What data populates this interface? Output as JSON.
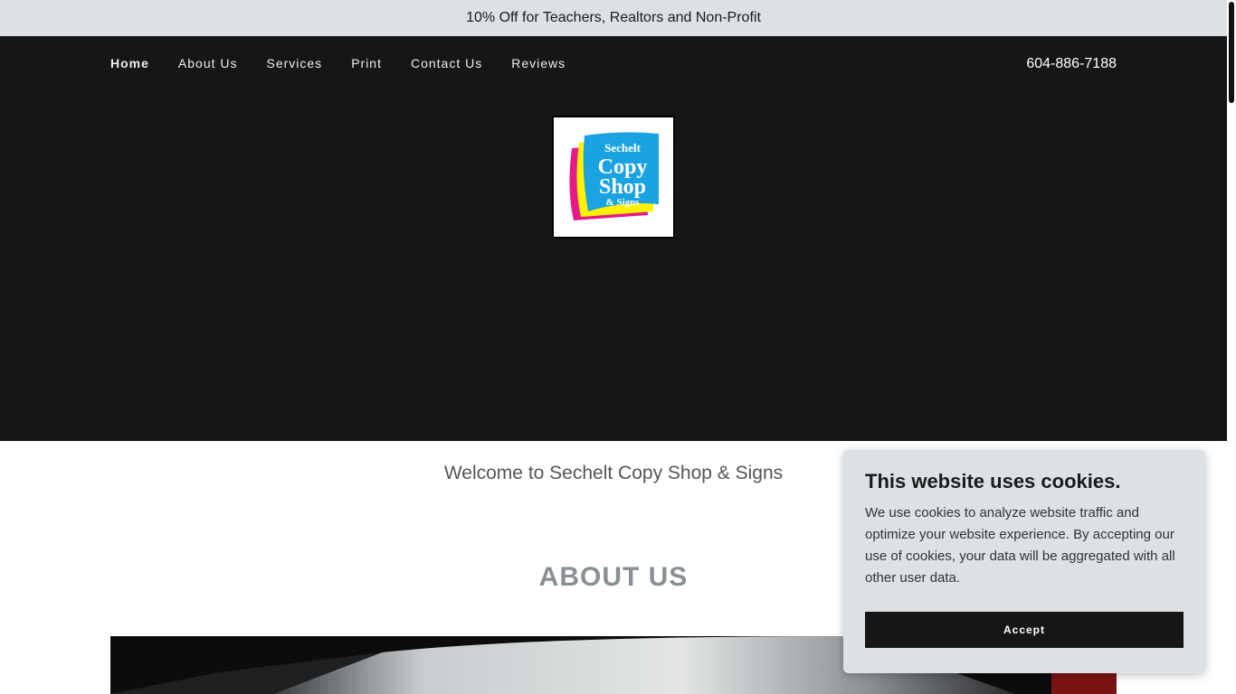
{
  "promo": {
    "text": "10% Off for Teachers, Realtors and Non-Profit"
  },
  "nav": {
    "items": [
      {
        "label": "Home"
      },
      {
        "label": "About Us"
      },
      {
        "label": "Services"
      },
      {
        "label": "Print"
      },
      {
        "label": "Contact Us"
      },
      {
        "label": "Reviews"
      }
    ],
    "active": "Home",
    "phone": "604-886-7188"
  },
  "logo": {
    "line1": "Sechelt",
    "line2": "Copy",
    "line3": "Shop",
    "line4": "& Signs"
  },
  "main": {
    "welcome": "Welcome to Sechelt Copy Shop & Signs",
    "about_heading": "ABOUT US"
  },
  "cookie_banner": {
    "title": "This website uses cookies.",
    "body": "We use cookies to analyze website traffic and optimize your website experience. By accepting our use of cookies, your data will be aggregated with all other user data.",
    "accept_label": "Accept"
  },
  "colors": {
    "promo_bg": "#dde1e4",
    "hero_bg": "#161617",
    "heading_gray": "#8a8f93",
    "logo_blue": "#1aa3e0",
    "logo_magenta": "#e6198a",
    "logo_yellow": "#fff200"
  }
}
